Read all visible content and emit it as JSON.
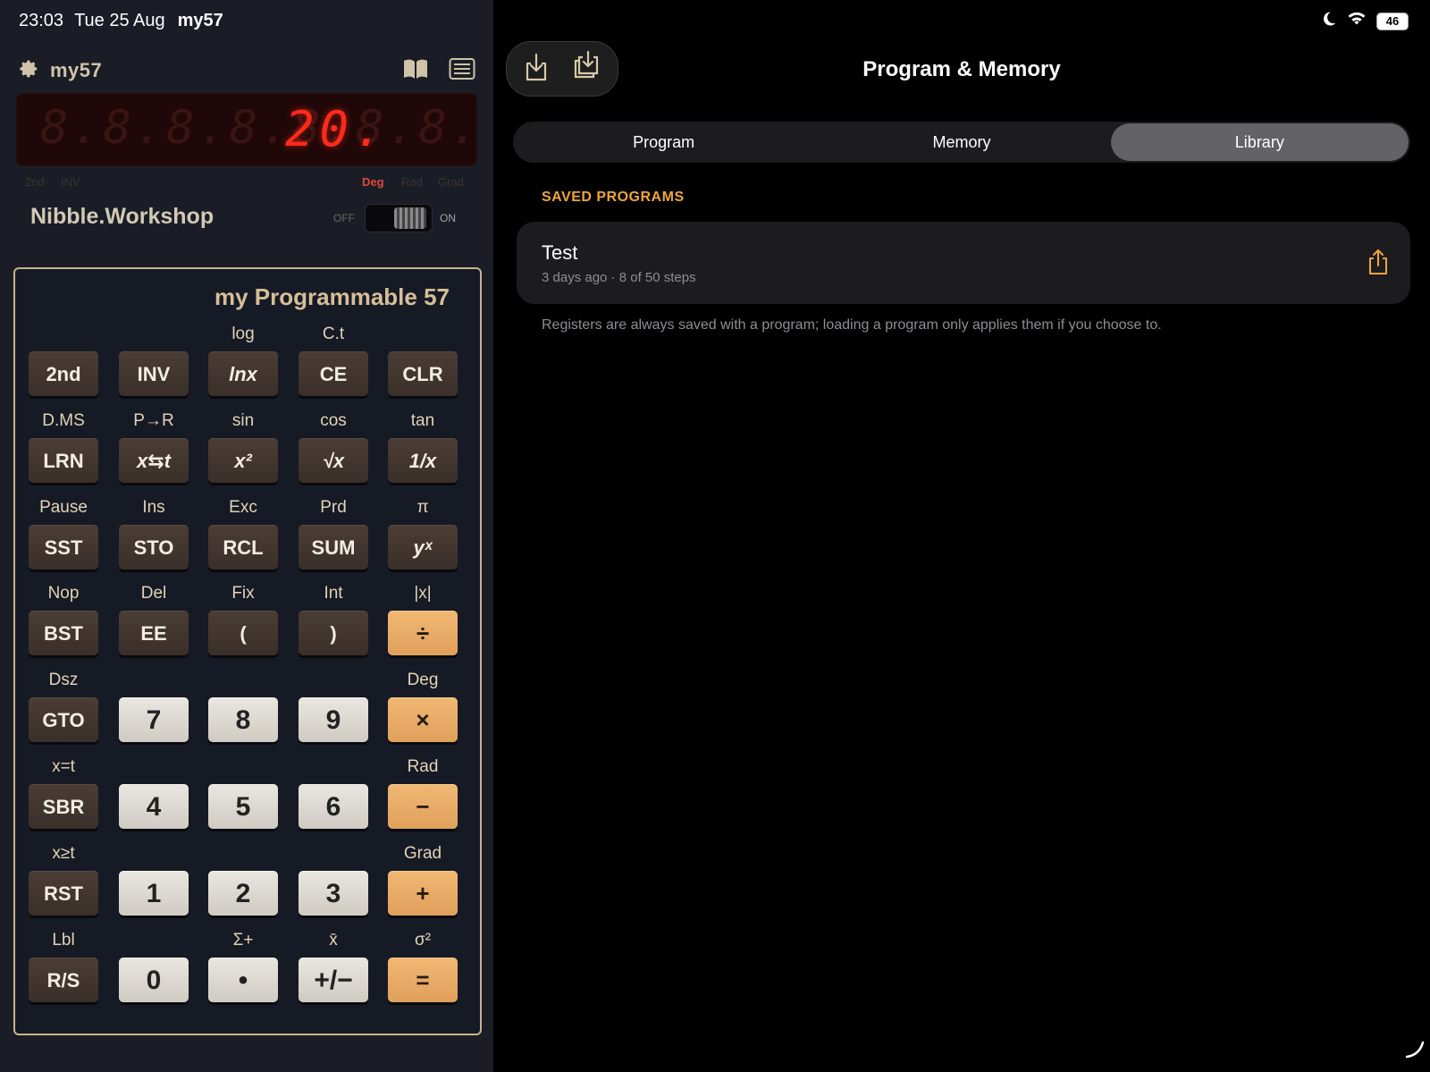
{
  "status": {
    "time": "23:03",
    "date": "Tue 25 Aug",
    "app": "my57",
    "battery": "46"
  },
  "header": {
    "title": "my57",
    "icons": [
      "gear-icon",
      "book-icon",
      "list-icon"
    ]
  },
  "display": {
    "value": "20.",
    "ghost": "8.8.8.8.8.8.8.   8.8.8."
  },
  "indicators": {
    "second": "2nd",
    "inv": "INV",
    "deg": "Deg",
    "rad": "Rad",
    "grad": "Grad",
    "active": "Deg"
  },
  "brand": "Nibble.Workshop",
  "switch": {
    "off": "OFF",
    "on": "ON",
    "state": "on"
  },
  "keypad": {
    "title": "my Programmable 57",
    "rows": [
      [
        {
          "shift": "",
          "label": "2nd"
        },
        {
          "shift": "",
          "label": "INV"
        },
        {
          "shift": "log",
          "label": "lnx"
        },
        {
          "shift": "C.t",
          "label": "CE"
        },
        {
          "shift": "",
          "label": "CLR"
        }
      ],
      [
        {
          "shift": "D.MS",
          "label": "LRN"
        },
        {
          "shift": "P→R",
          "label": "x⇆t"
        },
        {
          "shift": "sin",
          "label": "x²"
        },
        {
          "shift": "cos",
          "label": "√x"
        },
        {
          "shift": "tan",
          "label": "1/x"
        }
      ],
      [
        {
          "shift": "Pause",
          "label": "SST"
        },
        {
          "shift": "Ins",
          "label": "STO"
        },
        {
          "shift": "Exc",
          "label": "RCL"
        },
        {
          "shift": "Prd",
          "label": "SUM"
        },
        {
          "shift": "π",
          "label": "yˣ"
        }
      ],
      [
        {
          "shift": "Nop",
          "label": "BST"
        },
        {
          "shift": "Del",
          "label": "EE"
        },
        {
          "shift": "Fix",
          "label": "("
        },
        {
          "shift": "Int",
          "label": ")"
        },
        {
          "shift": "|x|",
          "label": "÷"
        }
      ],
      [
        {
          "shift": "Dsz",
          "label": "GTO"
        },
        {
          "shift": "",
          "label": "7"
        },
        {
          "shift": "",
          "label": "8"
        },
        {
          "shift": "",
          "label": "9"
        },
        {
          "shift": "Deg",
          "label": "×"
        }
      ],
      [
        {
          "shift": "x=t",
          "label": "SBR"
        },
        {
          "shift": "",
          "label": "4"
        },
        {
          "shift": "",
          "label": "5"
        },
        {
          "shift": "",
          "label": "6"
        },
        {
          "shift": "Rad",
          "label": "−"
        }
      ],
      [
        {
          "shift": "x≥t",
          "label": "RST"
        },
        {
          "shift": "",
          "label": "1"
        },
        {
          "shift": "",
          "label": "2"
        },
        {
          "shift": "",
          "label": "3"
        },
        {
          "shift": "Grad",
          "label": "+"
        }
      ],
      [
        {
          "shift": "Lbl",
          "label": "R/S"
        },
        {
          "shift": "",
          "label": "0"
        },
        {
          "shift": "Σ+",
          "label": "•"
        },
        {
          "shift": "x̄",
          "label": "+/−"
        },
        {
          "shift": "σ²",
          "label": "="
        }
      ]
    ]
  },
  "right": {
    "title": "Program & Memory",
    "tabs": [
      "Program",
      "Memory",
      "Library"
    ],
    "selected_tab": "Library",
    "section_header": "SAVED PROGRAMS",
    "programs": [
      {
        "name": "Test",
        "meta": "3 days ago · 8 of 50 steps"
      }
    ],
    "note": "Registers are always saved with a program; loading a program only applies them if you choose to."
  },
  "colors": {
    "accent": "#f0a53a",
    "display_red": "#ff2a1a",
    "orange_key": "#e8ad68",
    "frame_gold": "#c7b48e"
  }
}
